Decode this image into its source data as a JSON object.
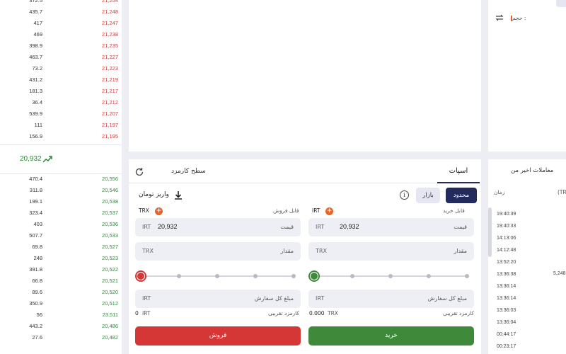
{
  "order_book": {
    "sell": [
      {
        "amount": "372.5",
        "price": "21,254"
      },
      {
        "amount": "435.7",
        "price": "21,248"
      },
      {
        "amount": "417",
        "price": "21,247"
      },
      {
        "amount": "469",
        "price": "21,238"
      },
      {
        "amount": "398.9",
        "price": "21,235"
      },
      {
        "amount": "463.7",
        "price": "21,227"
      },
      {
        "amount": "73.2",
        "price": "21,223"
      },
      {
        "amount": "431.2",
        "price": "21,219"
      },
      {
        "amount": "181.3",
        "price": "21,217"
      },
      {
        "amount": "36.4",
        "price": "21,212"
      },
      {
        "amount": "539.9",
        "price": "21,207"
      },
      {
        "amount": "111",
        "price": "21,197"
      },
      {
        "amount": "156.9",
        "price": "21,195"
      }
    ],
    "last_price": "20,932",
    "buy": [
      {
        "amount": "470.4",
        "price": "20,556"
      },
      {
        "amount": "311.8",
        "price": "20,546"
      },
      {
        "amount": "199.1",
        "price": "20,538"
      },
      {
        "amount": "323.4",
        "price": "20,537"
      },
      {
        "amount": "403",
        "price": "20,536"
      },
      {
        "amount": "507.7",
        "price": "20,533"
      },
      {
        "amount": "69.8",
        "price": "20,527"
      },
      {
        "amount": "248",
        "price": "20,523"
      },
      {
        "amount": "391.8",
        "price": "20,522"
      },
      {
        "amount": "66.8",
        "price": "20,521"
      },
      {
        "amount": "89.6",
        "price": "20,520"
      },
      {
        "amount": "350.9",
        "price": "20,512"
      },
      {
        "amount": "56",
        "price": "23,511"
      },
      {
        "amount": "443.2",
        "price": "20,486"
      },
      {
        "amount": "27.6",
        "price": "20,482"
      }
    ]
  },
  "chart_panel": {
    "volume_label": "حجم :"
  },
  "form": {
    "tab_spot": "اسپات",
    "tab_fee": "سطح کارمزد",
    "btn_limit": "محدود",
    "btn_market": "بازار",
    "deposit": "واریز تومان",
    "buy": {
      "available_label": "قابل خرید",
      "available_unit": "IRT",
      "price_label": "قیمت",
      "price_unit": "IRT",
      "price_value": "20,932",
      "amount_label": "مقدار",
      "amount_unit": "TRX",
      "total_label": "مبلغ کل سفارش",
      "total_unit": "IRT",
      "fee_label": "کارمزد تقریبی",
      "fee_unit": "TRX",
      "fee_value": "0.000",
      "submit": "خرید",
      "slider_percent": 0
    },
    "sell": {
      "available_label": "قابل فروش",
      "available_unit": "TRX",
      "price_label": "قیمت",
      "price_unit": "IRT",
      "price_value": "20,932",
      "amount_label": "مقدار",
      "amount_unit": "TRX",
      "total_label": "مبلغ کل سفارش",
      "total_unit": "IRT",
      "fee_label": "کارمزد تقریبی",
      "fee_unit": "IRT",
      "fee_value": "0",
      "submit": "فروش",
      "slider_percent": 0
    }
  },
  "trades": {
    "title": "معاملات اخیر من",
    "col_time": "زمان",
    "col_partial": "(TR",
    "times": [
      "19:40:39",
      "19:40:33",
      "14:13:06",
      "14:12:48",
      "13:52:20",
      "13:36:38",
      "13:36:14",
      "13:36:14",
      "13:36:03",
      "13:36:04",
      "00:44:17",
      "00:23:17"
    ],
    "partial_value": "5,248"
  },
  "colors": {
    "buy": "#3f8a3a",
    "sell": "#d53636",
    "primary": "#232a5c"
  }
}
